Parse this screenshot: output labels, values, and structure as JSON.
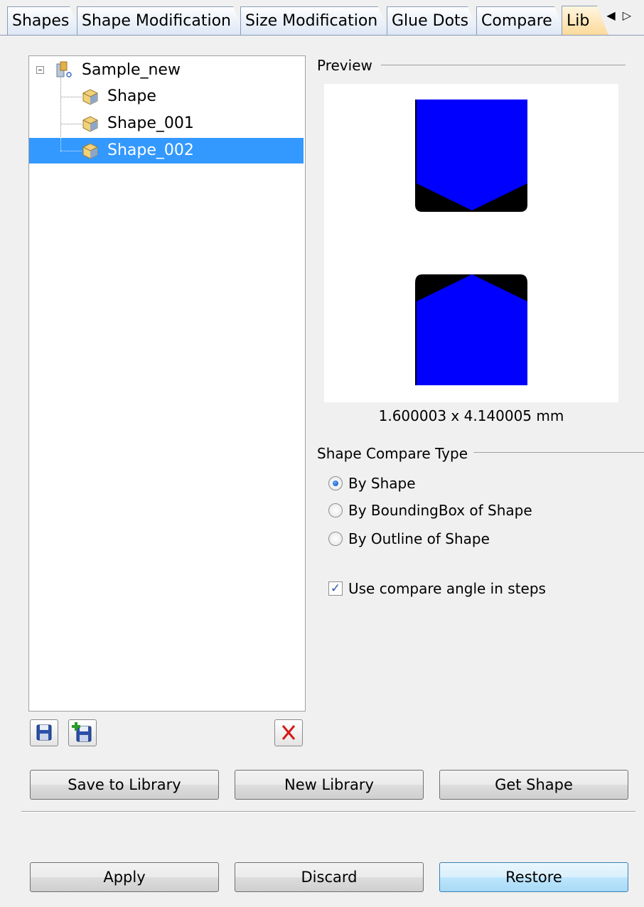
{
  "tabs": [
    {
      "label": "Shapes",
      "active": false
    },
    {
      "label": "Shape Modification",
      "active": false
    },
    {
      "label": "Size Modification",
      "active": false
    },
    {
      "label": "Glue Dots",
      "active": false
    },
    {
      "label": "Compare",
      "active": false
    },
    {
      "label": "Lib",
      "active": true
    }
  ],
  "tab_scroll": {
    "left": "◀",
    "right": "▷"
  },
  "tree": {
    "root": {
      "label": "Sample_new",
      "icon": "library-icon",
      "expanded": true
    },
    "children": [
      {
        "label": "Shape",
        "icon": "shape-icon",
        "selected": false
      },
      {
        "label": "Shape_001",
        "icon": "shape-icon",
        "selected": false
      },
      {
        "label": "Shape_002",
        "icon": "shape-icon",
        "selected": true
      }
    ]
  },
  "tree_actions": {
    "save_icon": "save-icon",
    "save_new_icon": "save-new-icon",
    "delete_icon": "delete-icon"
  },
  "preview": {
    "title": "Preview",
    "dimensions": "1.600003 x 4.140005 mm",
    "shape_color": "#0000ff",
    "outline_color": "#000000"
  },
  "compare": {
    "title": "Shape Compare Type",
    "options": [
      {
        "label": "By Shape",
        "checked": true
      },
      {
        "label": "By BoundingBox of Shape",
        "checked": false
      },
      {
        "label": "By Outline of Shape",
        "checked": false
      }
    ],
    "angle_checkbox": {
      "label": "Use compare angle in steps",
      "checked": true
    }
  },
  "buttons": {
    "save_to_library": "Save to Library",
    "new_library": "New Library",
    "get_shape": "Get Shape",
    "apply": "Apply",
    "discard": "Discard",
    "restore": "Restore"
  },
  "colors": {
    "selection": "#3399ff",
    "active_tab": "#fbd999",
    "focused_button": "#3c7fb1"
  }
}
